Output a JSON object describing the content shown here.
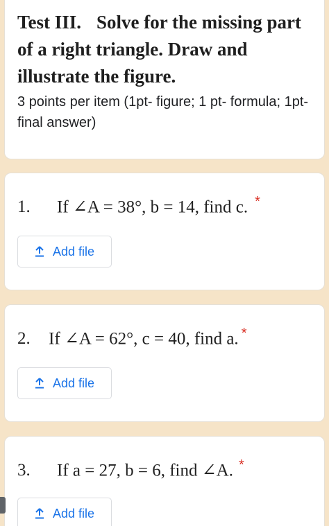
{
  "header": {
    "test_label": "Test III.",
    "title_line1": "Solve for the missing part",
    "title_line2": "of a right triangle. Draw and",
    "title_line3": "illustrate the figure.",
    "description": "3 points per item (1pt- figure; 1 pt- formula; 1pt- final answer)"
  },
  "questions": [
    {
      "number": "1.",
      "text": "If ∠A = 38°, b = 14, find c.",
      "required": "*",
      "button_label": "Add file"
    },
    {
      "number": "2.",
      "text": "If ∠A = 62°, c = 40, find a.",
      "required": "*",
      "button_label": "Add file"
    },
    {
      "number": "3.",
      "text": "If  a = 27, b = 6, find ∠A.",
      "required": "*",
      "button_label": "Add file"
    }
  ],
  "colors": {
    "background": "#f6e4c8",
    "accent_blue": "#1a73e8",
    "required_red": "#d93025"
  },
  "icons": {
    "upload": "upload-icon"
  }
}
